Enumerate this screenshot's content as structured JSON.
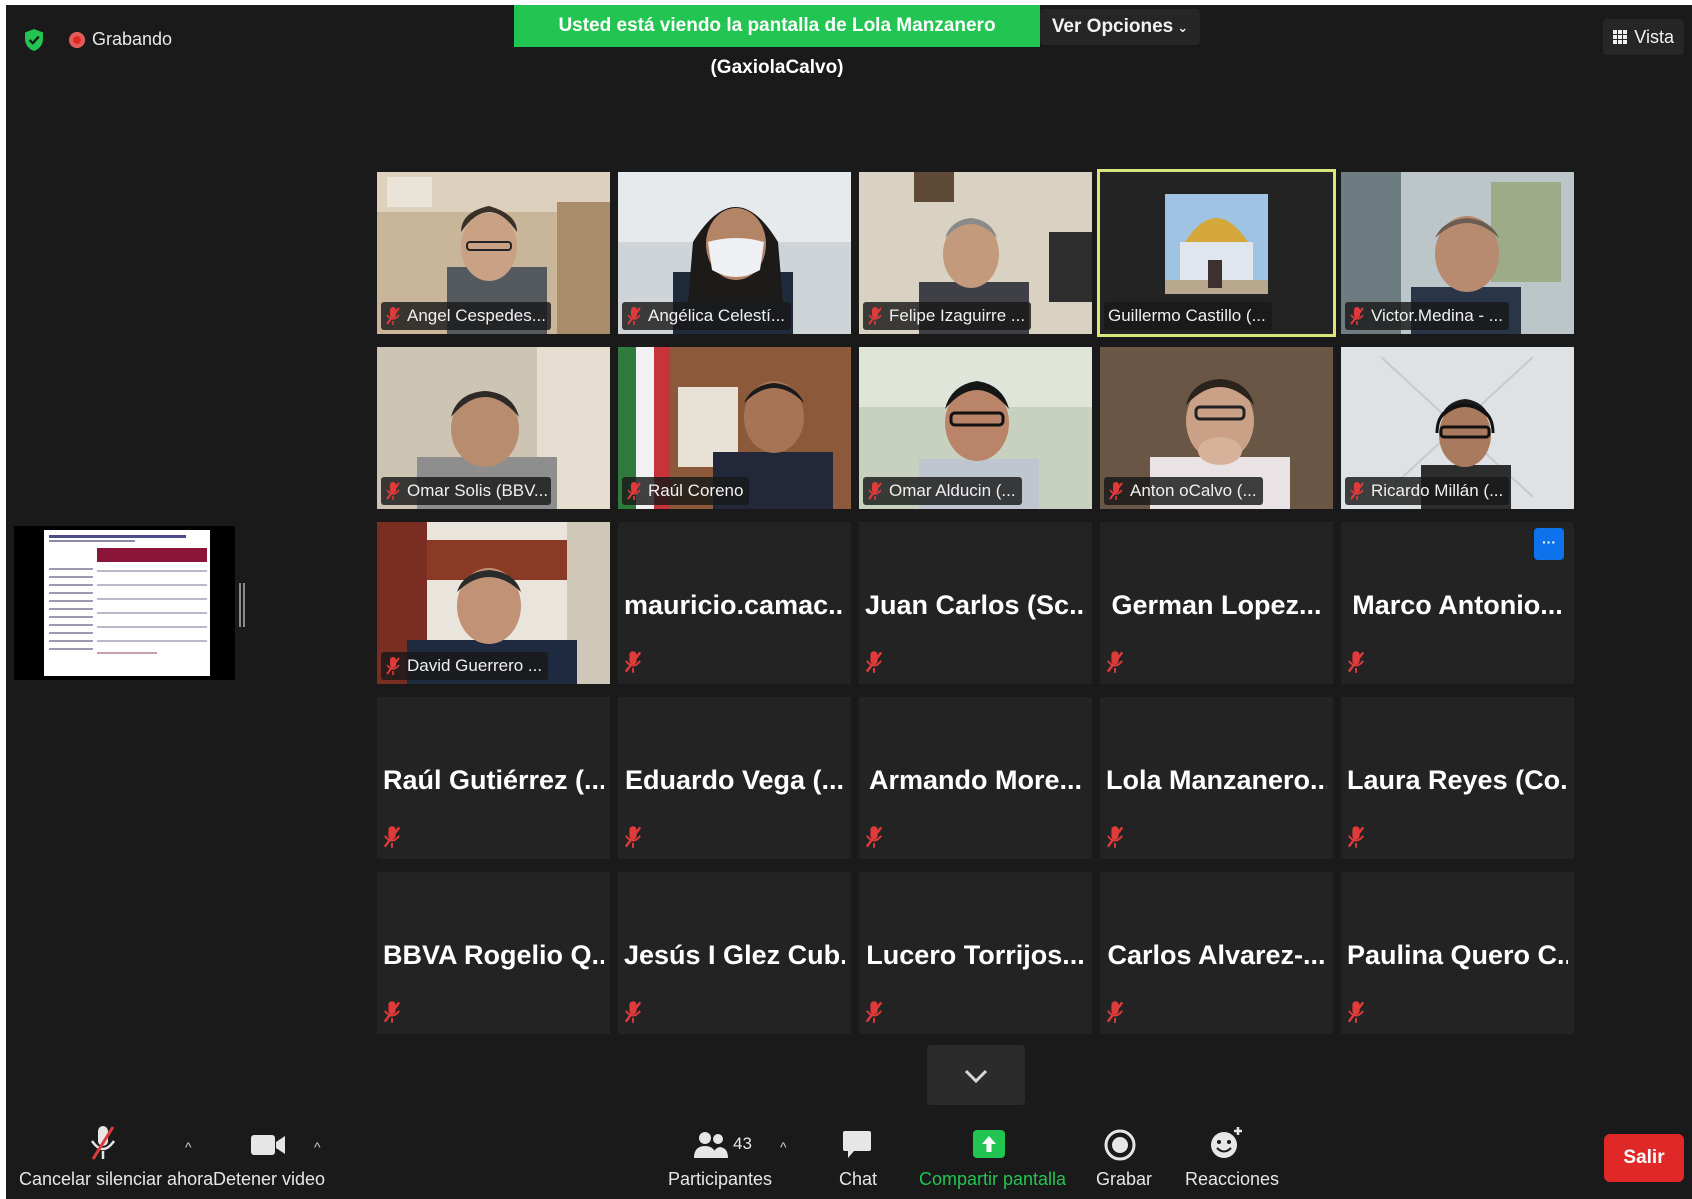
{
  "top_bar": {
    "recording_label": "Grabando",
    "share_banner": "Usted está viendo la pantalla de Lola Manzanero (GaxiolaCalvo)",
    "view_options": "Ver Opciones",
    "vista": "Vista"
  },
  "video_tiles": [
    {
      "name": "Angel Cespedes..."
    },
    {
      "name": "Angélica Celestí..."
    },
    {
      "name": "Felipe Izaguirre ..."
    },
    {
      "name": "Guillermo Castillo (..."
    },
    {
      "name": "Victor.Medina - ..."
    },
    {
      "name": "Omar Solis (BBV..."
    },
    {
      "name": "Raúl Coreno"
    },
    {
      "name": "Omar Alducin (..."
    },
    {
      "name": "Anton oCalvo (..."
    },
    {
      "name": "Ricardo Millán (..."
    },
    {
      "name": "David Guerrero ..."
    }
  ],
  "name_tiles": [
    {
      "name": "mauricio.camac..."
    },
    {
      "name": "Juan Carlos (Sc..."
    },
    {
      "name": "German Lopez..."
    },
    {
      "name": "Marco Antonio..."
    },
    {
      "name": "Raúl Gutiérrez (..."
    },
    {
      "name": "Eduardo Vega (..."
    },
    {
      "name": "Armando More..."
    },
    {
      "name": "Lola Manzanero..."
    },
    {
      "name": "Laura Reyes (Co..."
    },
    {
      "name": "BBVA Rogelio Q..."
    },
    {
      "name": "Jesús I Glez Cub..."
    },
    {
      "name": "Lucero Torrijos..."
    },
    {
      "name": "Carlos Alvarez-..."
    },
    {
      "name": "Paulina Quero C..."
    }
  ],
  "more_button": "···",
  "toolbar": {
    "unmute": "Cancelar silenciar ahora",
    "stop_video": "Detener video",
    "participants_count": "43",
    "participants": "Participantes",
    "chat": "Chat",
    "share_screen": "Compartir pantalla",
    "record": "Grabar",
    "reactions": "Reacciones",
    "leave": "Salir"
  },
  "colors": {
    "banner": "#23c552",
    "speaking_border": "#d8e67a",
    "leave": "#e02828",
    "more_button": "#0e72ed",
    "muted_icon": "#e03a3a"
  },
  "icons": [
    "shield-icon",
    "recording-icon",
    "grid-icon",
    "chevron-down-icon",
    "microphone-muted-icon",
    "video-camera-icon",
    "participants-icon",
    "chat-icon",
    "share-screen-icon",
    "record-icon",
    "reactions-icon"
  ]
}
